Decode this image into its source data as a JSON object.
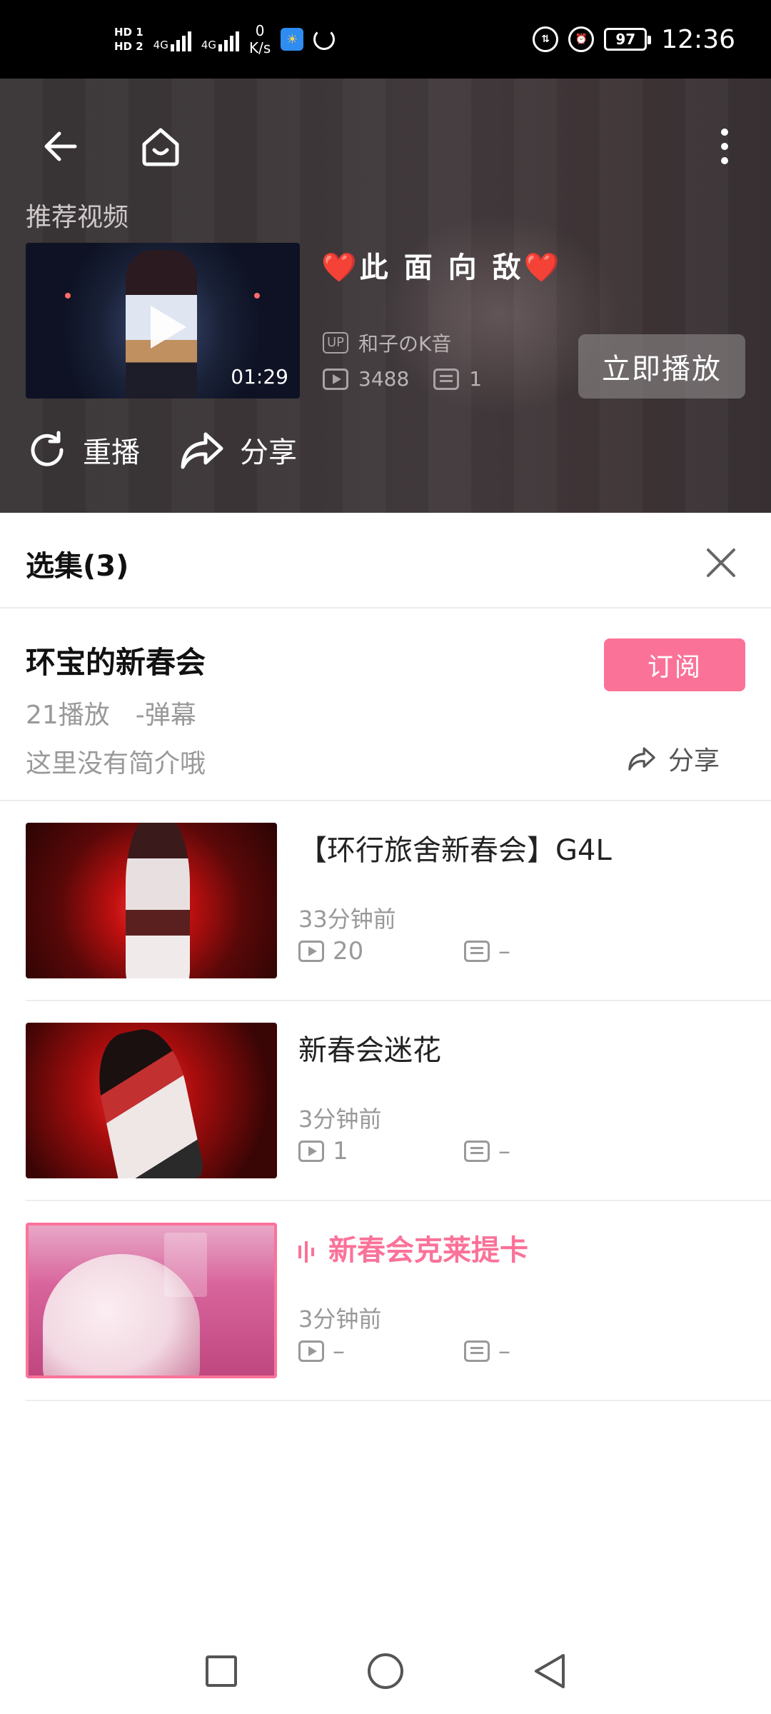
{
  "status_bar": {
    "hd1": "HD 1",
    "hd2": "HD 2",
    "net1": "4G",
    "net2": "4G",
    "speed_value": "0",
    "speed_unit": "K/s",
    "battery": "97",
    "time": "12:36"
  },
  "hero": {
    "section_label": "推荐视频",
    "video": {
      "title": "❤️此 面 向 敌❤️",
      "duration": "01:29",
      "up_badge": "UP",
      "uploader": "和子のK音",
      "plays": "3488",
      "danmaku": "1"
    },
    "play_now_label": "立即播放",
    "replay_label": "重播",
    "share_label": "分享"
  },
  "episodes_panel": {
    "title": "选集(3)",
    "collection": {
      "name": "环宝的新春会",
      "stats": "21播放　-弹幕",
      "description": "这里没有简介哦",
      "subscribe_label": "订阅",
      "share_label": "分享"
    },
    "episodes": [
      {
        "title": "【环行旅舍新春会】G4L",
        "time": "33分钟前",
        "plays": "20",
        "danmaku": "–",
        "current": false
      },
      {
        "title": "新春会迷花",
        "time": "3分钟前",
        "plays": "1",
        "danmaku": "–",
        "current": false
      },
      {
        "title": "新春会克莱提卡",
        "time": "3分钟前",
        "plays": "–",
        "danmaku": "–",
        "current": true
      }
    ]
  },
  "colors": {
    "accent_pink": "#fb7299",
    "hero_bg": "#3c3638",
    "muted_text": "#999999"
  },
  "icons": {
    "back": "arrow-left-icon",
    "home": "home-icon",
    "more": "more-vertical-icon",
    "replay": "replay-icon",
    "share": "share-icon",
    "close": "close-icon",
    "nav_recent": "square-icon",
    "nav_home": "circle-icon",
    "nav_back": "triangle-back-icon"
  }
}
